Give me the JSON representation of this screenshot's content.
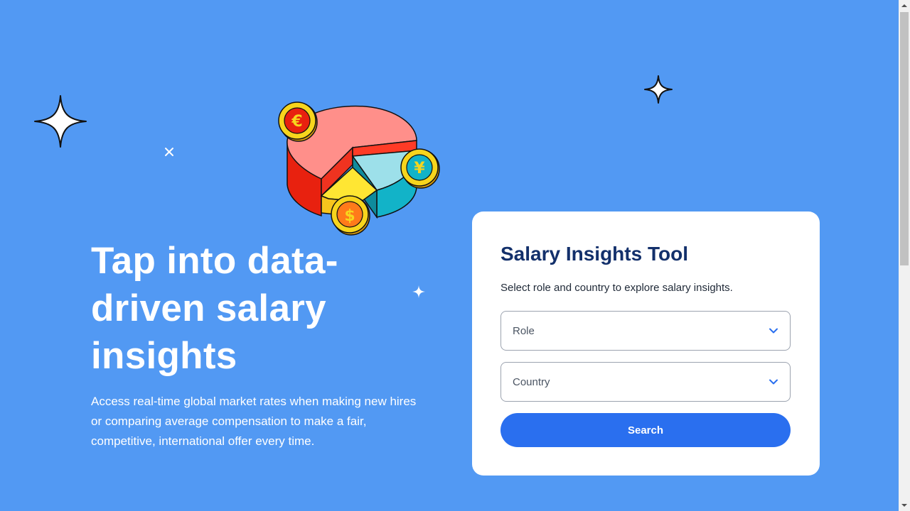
{
  "hero": {
    "title": "Tap into data-driven salary insights",
    "subtitle": "Access real-time global market rates when making new hires or comparing average compensation to make a fair, competitive, international offer every time."
  },
  "illustration": {
    "coins": [
      "€",
      "¥",
      "$"
    ],
    "colors": {
      "pie_pink": "#ff8f8a",
      "pie_red": "#e8210f",
      "pie_cyan": "#9de0ea",
      "pie_teal": "#12b3c8",
      "pie_yellow": "#ffe633",
      "coin_gold": "#f7d51d"
    }
  },
  "card": {
    "title": "Salary Insights Tool",
    "description": "Select role and country to explore salary insights.",
    "role_select": {
      "placeholder": "Role"
    },
    "country_select": {
      "placeholder": "Country"
    },
    "search_label": "Search"
  },
  "colors": {
    "background": "#5299f3",
    "card_title": "#13306b",
    "button": "#2a6fef",
    "chevron": "#2a6fef"
  },
  "icons": [
    "sparkle-icon",
    "chevron-down-icon",
    "euro-coin-icon",
    "yen-coin-icon",
    "dollar-coin-icon"
  ]
}
